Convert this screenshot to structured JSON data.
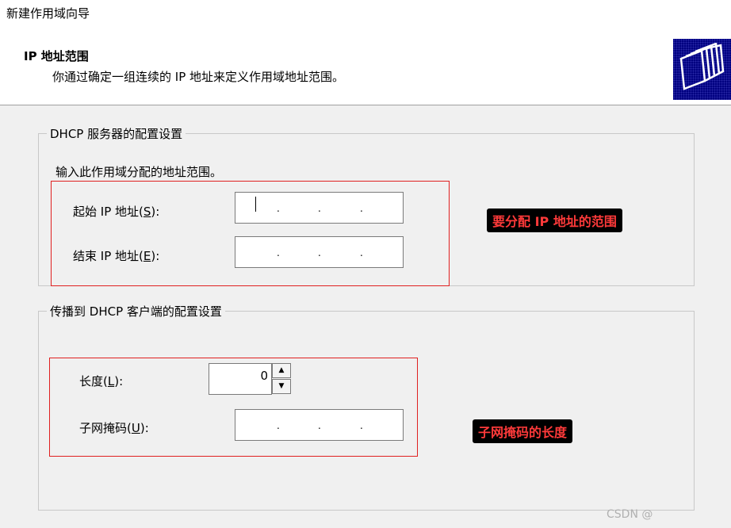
{
  "window": {
    "title": "新建作用域向导"
  },
  "header": {
    "title": "IP 地址范围",
    "subtitle": "你通过确定一组连续的 IP 地址来定义作用域地址范围。",
    "icon": "folders-icon"
  },
  "dhcp_group": {
    "legend": "DHCP 服务器的配置设置",
    "instruction": "输入此作用域分配的地址范围。",
    "start_ip": {
      "label": "起始 IP 地址(",
      "accel": "S",
      "suffix": "):",
      "dot": "."
    },
    "end_ip": {
      "label": "结束 IP 地址(",
      "accel": "E",
      "suffix": "):",
      "dot": "."
    }
  },
  "client_group": {
    "legend": "传播到 DHCP 客户端的配置设置",
    "length": {
      "label": "长度(",
      "accel": "L",
      "suffix": "):",
      "value": "0"
    },
    "subnet_mask": {
      "label": "子网掩码(",
      "accel": "U",
      "suffix": "):",
      "dot": "."
    }
  },
  "annotations": {
    "range_note": "要分配 IP 地址的范围",
    "mask_note": "子网掩码的长度",
    "color": "#e02020"
  },
  "watermark": "CSDN @"
}
